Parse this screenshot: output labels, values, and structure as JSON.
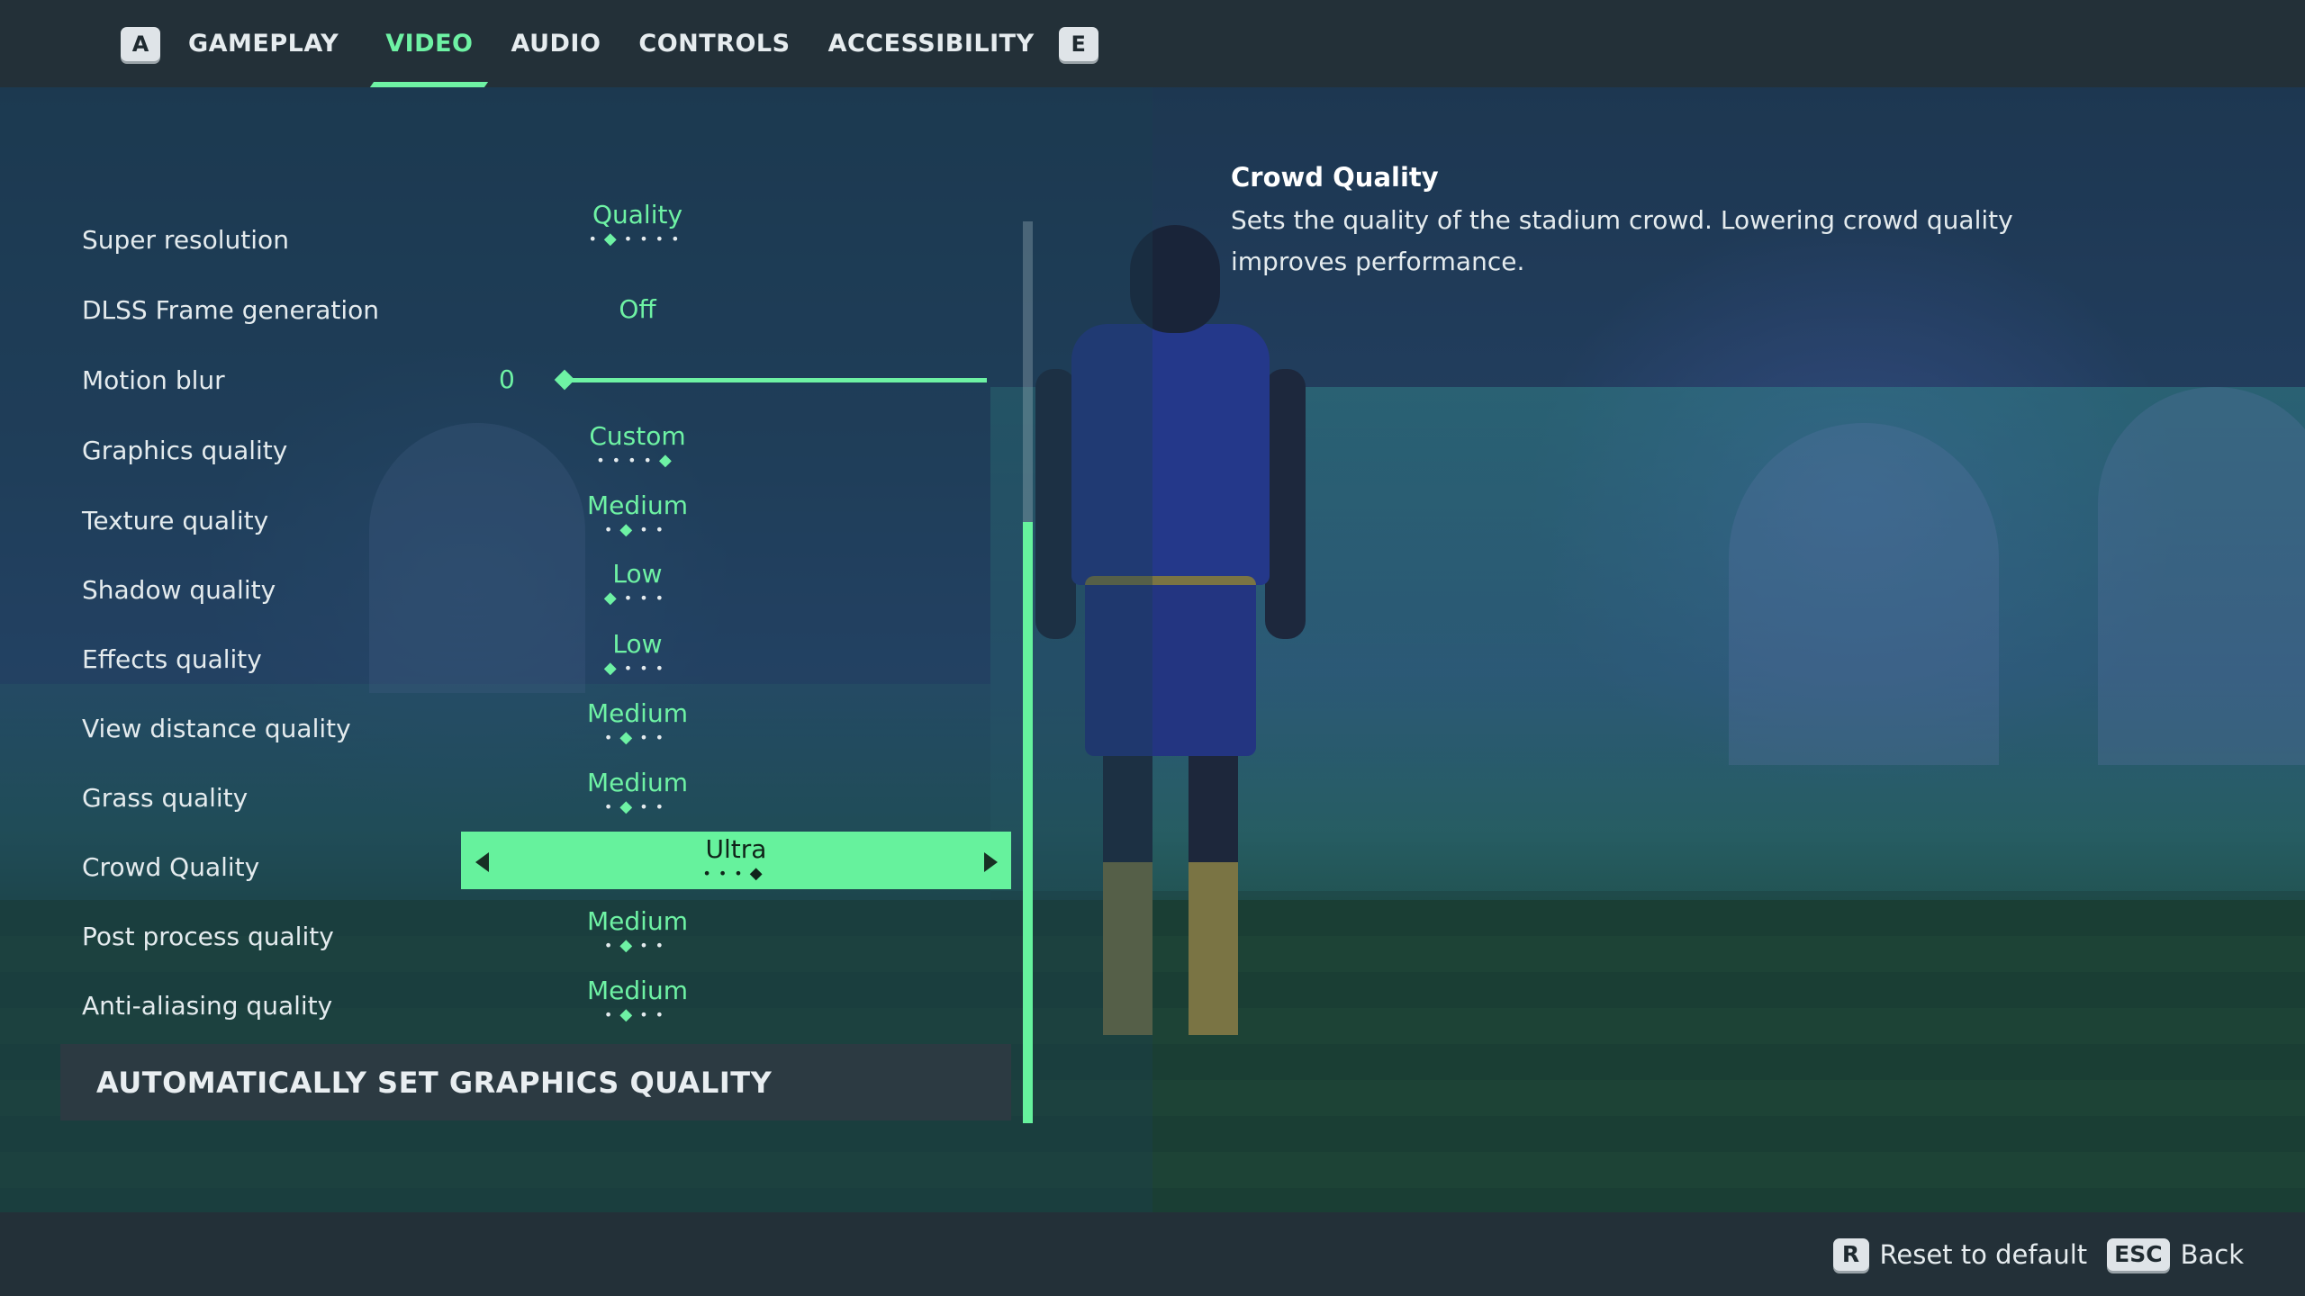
{
  "nav": {
    "left_key": "A",
    "right_key": "E",
    "tabs": [
      {
        "label": "GAMEPLAY",
        "active": false
      },
      {
        "label": "VIDEO",
        "active": true
      },
      {
        "label": "AUDIO",
        "active": false
      },
      {
        "label": "CONTROLS",
        "active": false
      },
      {
        "label": "ACCESSIBILITY",
        "active": false
      }
    ]
  },
  "settings": [
    {
      "label": "Super resolution",
      "value": "Quality",
      "dots": 6,
      "level": 2,
      "type": "selector"
    },
    {
      "label": "DLSS Frame generation",
      "value": "Off",
      "type": "selector"
    },
    {
      "label": "Motion blur",
      "value": "0",
      "slider_fraction": 0,
      "type": "slider"
    },
    {
      "label": "Graphics quality",
      "value": "Custom",
      "dots": 5,
      "level": 5,
      "type": "selector"
    },
    {
      "label": "Texture quality",
      "value": "Medium",
      "dots": 4,
      "level": 2,
      "type": "selector"
    },
    {
      "label": "Shadow quality",
      "value": "Low",
      "dots": 4,
      "level": 1,
      "type": "selector"
    },
    {
      "label": "Effects quality",
      "value": "Low",
      "dots": 4,
      "level": 1,
      "type": "selector"
    },
    {
      "label": "View distance quality",
      "value": "Medium",
      "dots": 4,
      "level": 2,
      "type": "selector"
    },
    {
      "label": "Grass quality",
      "value": "Medium",
      "dots": 4,
      "level": 2,
      "type": "selector"
    },
    {
      "label": "Crowd Quality",
      "value": "Ultra",
      "dots": 4,
      "level": 4,
      "type": "selector",
      "selected": true
    },
    {
      "label": "Post process quality",
      "value": "Medium",
      "dots": 4,
      "level": 2,
      "type": "selector"
    },
    {
      "label": "Anti-aliasing quality",
      "value": "Medium",
      "dots": 4,
      "level": 2,
      "type": "selector"
    }
  ],
  "auto_button": "AUTOMATICALLY SET GRAPHICS QUALITY",
  "description": {
    "title": "Crowd Quality",
    "text": "Sets the quality of the stadium crowd. Lowering crowd quality improves performance."
  },
  "footer": {
    "reset_key": "R",
    "reset_label": "Reset to default",
    "back_key": "ESC",
    "back_label": "Back"
  },
  "colors": {
    "accent": "#6ef2a4",
    "bar_bg": "#233038"
  }
}
